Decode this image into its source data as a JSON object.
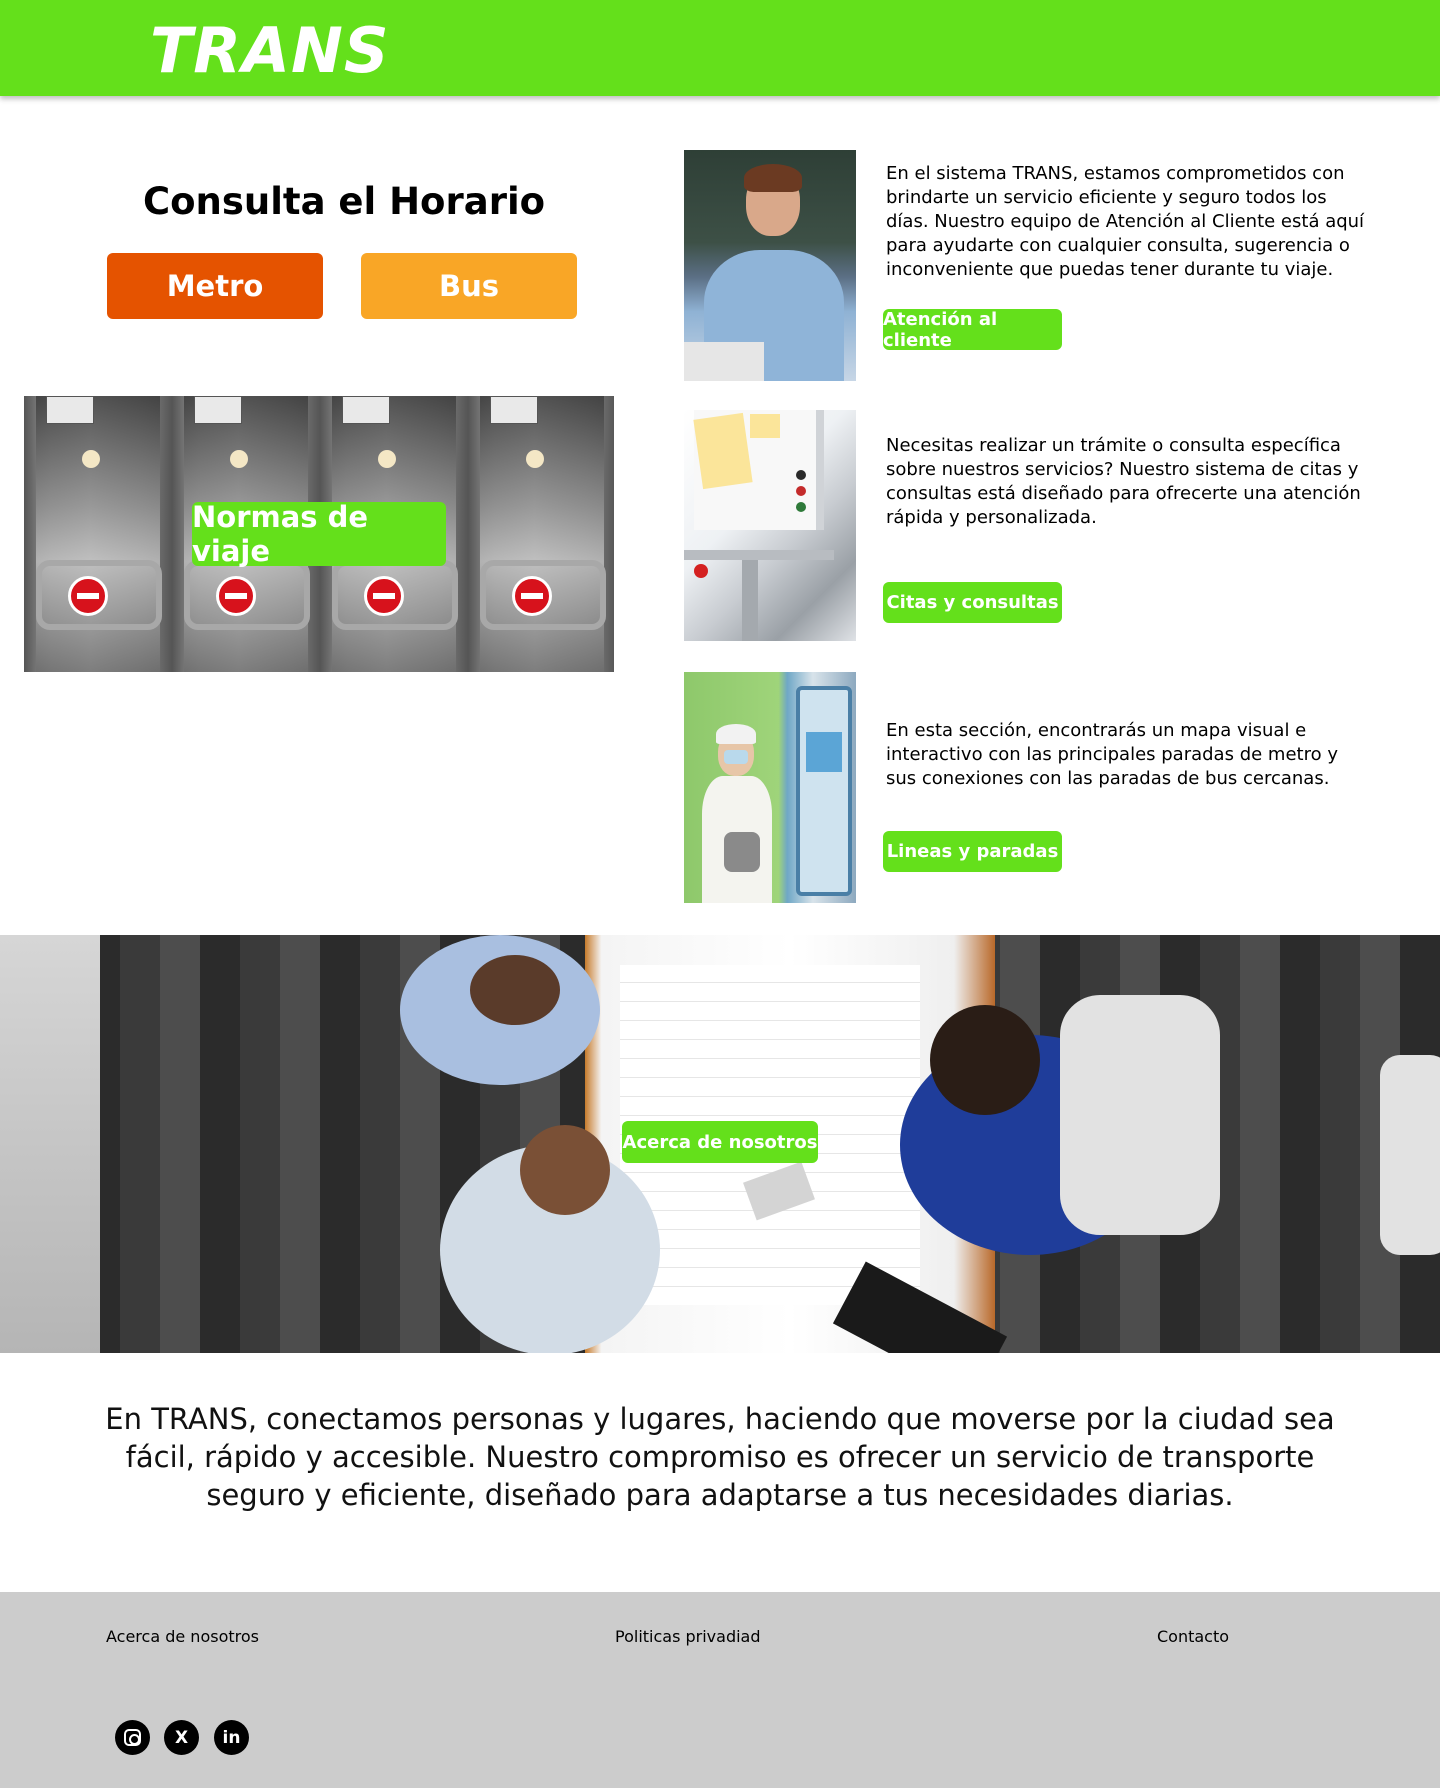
{
  "header": {
    "logo": "TRANS",
    "color": "#64e01b"
  },
  "schedule": {
    "title": "Consulta el Horario",
    "metro_label": "Metro",
    "bus_label": "Bus",
    "metro_color": "#e55300",
    "bus_color": "#f9a626"
  },
  "rules": {
    "button_label": "Normas de viaje"
  },
  "info": [
    {
      "text": "En el sistema TRANS, estamos comprometidos con brindarte un servicio eficiente y seguro todos los días. Nuestro equipo de Atención al Cliente está aquí para ayudarte con cualquier consulta, sugerencia o inconveniente que puedas tener durante tu viaje.",
      "button": "Atención al cliente"
    },
    {
      "text": "Necesitas realizar un trámite o consulta específica sobre nuestros servicios? Nuestro sistema de citas y consultas está diseñado para ofrecerte una atención rápida y personalizada.",
      "button": "Citas y consultas"
    },
    {
      "text": "En esta sección, encontrarás un mapa visual e interactivo con las principales paradas de metro y sus conexiones con las paradas de bus cercanas.",
      "button": "Lineas y paradas"
    }
  ],
  "about": {
    "button_label": "Acerca de nosotros"
  },
  "mission": "En TRANS, conectamos personas y lugares, haciendo que moverse por la ciudad sea fácil, rápido y accesible. Nuestro compromiso es ofrecer un servicio de transporte seguro y eficiente, diseñado para adaptarse a tus necesidades diarias.",
  "footer": {
    "links": [
      "Acerca de nosotros",
      "Politicas privadiad",
      "Contacto"
    ],
    "social_icons": [
      "instagram-icon",
      "x-icon",
      "linkedin-icon"
    ],
    "x_glyph": "X",
    "linkedin_glyph": "in"
  }
}
